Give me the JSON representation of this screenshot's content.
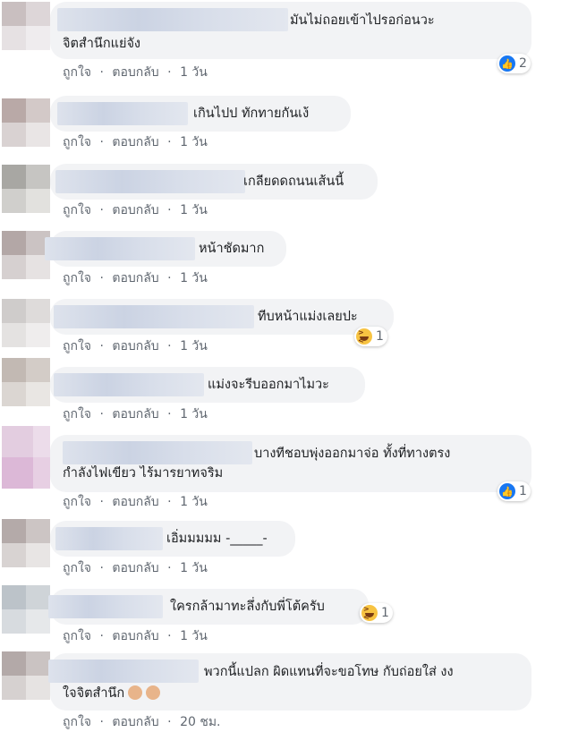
{
  "colors": {
    "bubble": "#f2f3f5",
    "meta_text": "#606770",
    "like_blue": "#1877f2",
    "haha_yellow": "#f7c342"
  },
  "action_like": "ถูกใจ",
  "action_reply": "ตอบกลับ",
  "separator": "·",
  "comments": [
    {
      "text1": "มันไม่ถอยเข้าไปรอก่อนวะ",
      "text2": "จิตสำนึกแย่จัง",
      "time": "1 วัน",
      "reaction": {
        "icon": "like-icon",
        "count": "2"
      }
    },
    {
      "text1": "เกินไปป ทักทายกันเง้",
      "time": "1 วัน"
    },
    {
      "text1": "เกลียดดถนนเส้นนี้",
      "time": "1 วัน"
    },
    {
      "text1": "หน้าชัดมาก",
      "time": "1 วัน"
    },
    {
      "text1": "ทีบหน้าแม่งเลยปะ",
      "time": "1 วัน",
      "reaction": {
        "icon": "haha-icon",
        "count": "1"
      }
    },
    {
      "text1": "แม่งจะรีบออกมาไมวะ",
      "time": "1 วัน"
    },
    {
      "text1": "บางทีชอบพุ่งออกมาจ่อ ทั้งที่ทางตรง",
      "text2": "กำลังไฟเขียว ไร้มารยาทจริม",
      "time": "1 วัน",
      "reaction": {
        "icon": "like-icon",
        "count": "1"
      }
    },
    {
      "text1": "เอิ่มมมมม -_____-",
      "time": "1 วัน"
    },
    {
      "text1": "ใครกล้ามาทะลึ่งกับพี่โต้ครับ",
      "time": "1 วัน",
      "reaction": {
        "icon": "haha-icon",
        "count": "1"
      }
    },
    {
      "text1": "พวกนี้แปลก ผิดแทนที่จะขอโทษ กับถ่อยใส่ งง",
      "text2": "ใจจิตสำนึก",
      "time": "20 ชม.",
      "emojis": [
        "person-facepalming-emoji",
        "person-facepalming-emoji"
      ]
    }
  ]
}
